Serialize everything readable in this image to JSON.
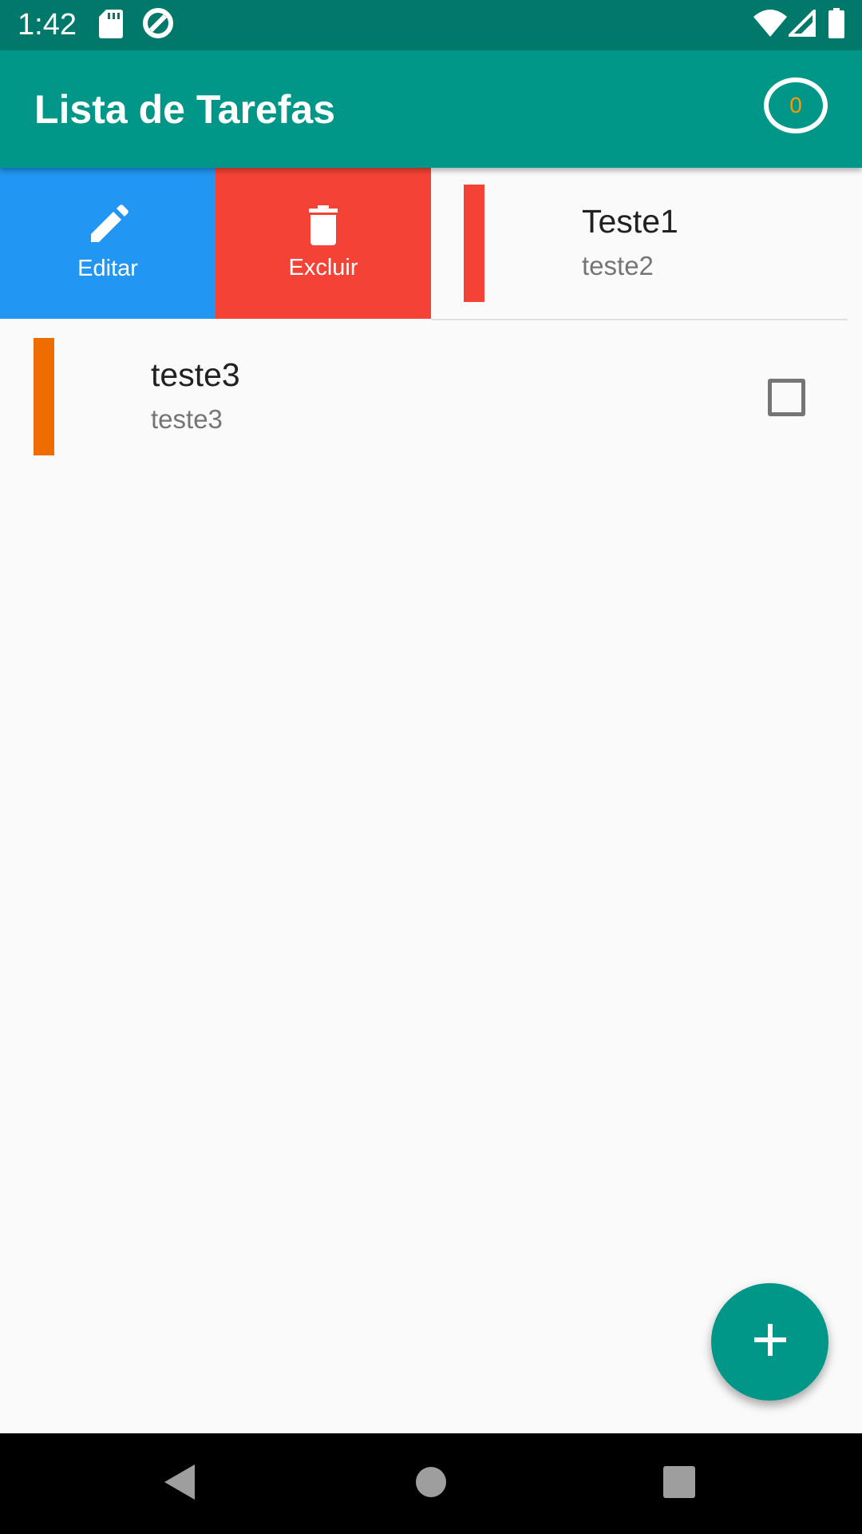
{
  "status_bar": {
    "time": "1:42",
    "left_icons": [
      "sd-card-icon",
      "data-saver-icon"
    ],
    "right_icons": [
      "wifi-icon",
      "cell-signal-icon",
      "battery-icon"
    ]
  },
  "app_bar": {
    "title": "Lista de Tarefas",
    "counter": "0",
    "background_color": "#009688",
    "counter_color": "#ff9800"
  },
  "swipe_actions": {
    "edit_label": "Editar",
    "edit_icon": "pencil-icon",
    "edit_color": "#2196f3",
    "delete_label": "Excluir",
    "delete_icon": "trash-icon",
    "delete_color": "#f44336"
  },
  "tasks": [
    {
      "title": "Teste1",
      "description": "teste2",
      "color": "#f44336",
      "swiped_open": true
    },
    {
      "title": "teste3",
      "description": "teste3",
      "color": "#ef6c00",
      "checked": false
    }
  ],
  "fab": {
    "icon": "plus-icon"
  },
  "nav_bar": {
    "icons": [
      "back-icon",
      "home-icon",
      "recents-icon"
    ]
  }
}
